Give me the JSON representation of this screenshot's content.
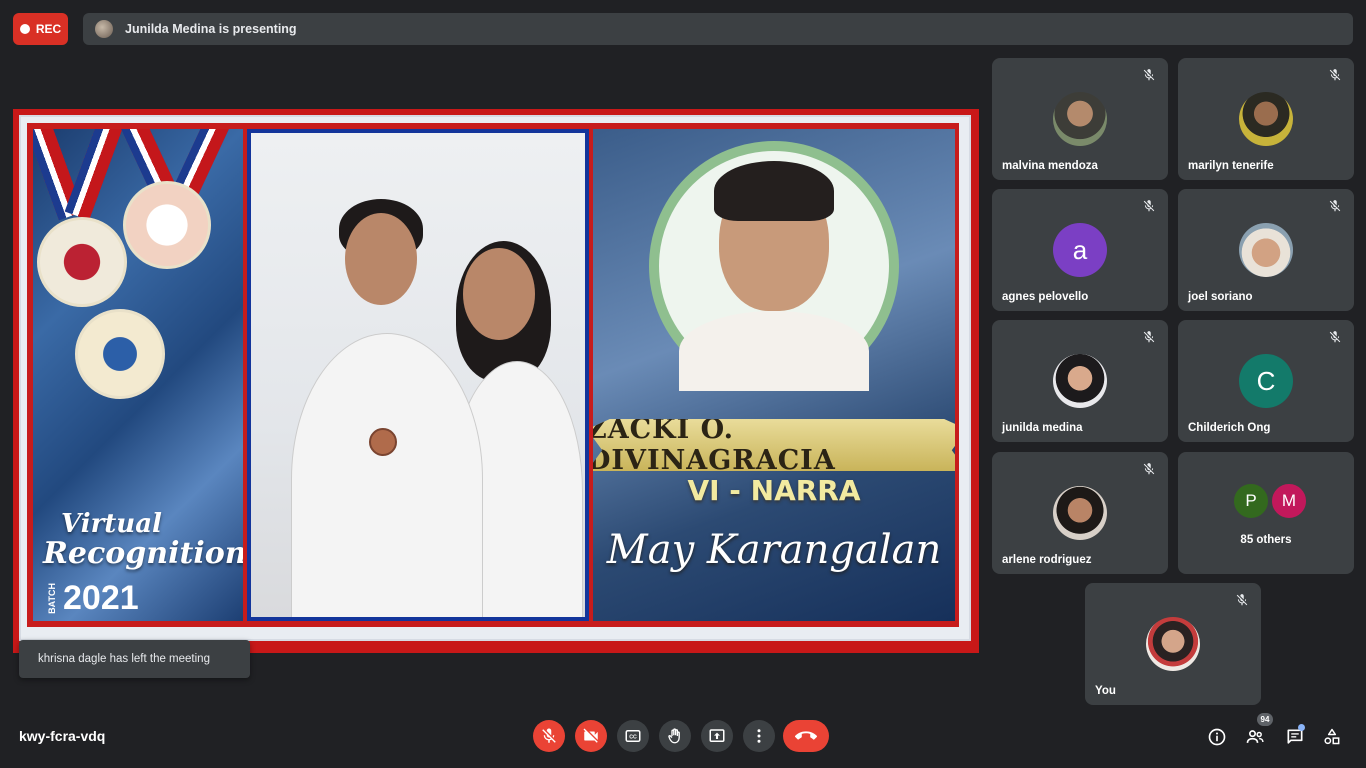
{
  "recording": {
    "label": "REC"
  },
  "presenter": {
    "text": "Junilda Medina is presenting"
  },
  "slide": {
    "event_title_line1": "Virtual",
    "event_title_line2": "Recognition",
    "batch_label": "BATCH",
    "year": "2021",
    "student_name": "ZACKI O. DIVINAGRACIA",
    "section": "VI - NARRA",
    "honor": "May Karangalan"
  },
  "notification": {
    "text": "khrisna dagle has left the meeting"
  },
  "participants": [
    {
      "name": "malvina mendoza",
      "avatar": "photo",
      "muted": true
    },
    {
      "name": "marilyn tenerife",
      "avatar": "photo",
      "muted": true
    },
    {
      "name": "agnes pelovello",
      "avatar": "letter",
      "initial": "a",
      "color": "#7b3fc4",
      "muted": true
    },
    {
      "name": "joel soriano",
      "avatar": "photo",
      "muted": true
    },
    {
      "name": "junilda medina",
      "avatar": "photo",
      "muted": true
    },
    {
      "name": "Childerich Ong",
      "avatar": "letter",
      "initial": "C",
      "color": "#137a6a",
      "muted": true
    },
    {
      "name": "arlene rodriguez",
      "avatar": "photo",
      "muted": true
    }
  ],
  "others": {
    "initials": [
      "P",
      "M"
    ],
    "colors": [
      "#33691e",
      "#c2185b"
    ],
    "label": "85 others"
  },
  "self": {
    "name": "You",
    "muted": true
  },
  "meeting": {
    "code": "kwy-fcra-vdq"
  },
  "controls": {
    "mic": "mic-off-icon",
    "camera": "camera-off-icon",
    "captions": "captions-icon",
    "raise_hand": "raise-hand-icon",
    "present": "present-screen-icon",
    "more": "more-options-icon",
    "end_call": "end-call-icon"
  },
  "right_controls": {
    "info": "info-icon",
    "people_count": "94",
    "chat": "chat-icon",
    "activities": "activities-icon"
  }
}
